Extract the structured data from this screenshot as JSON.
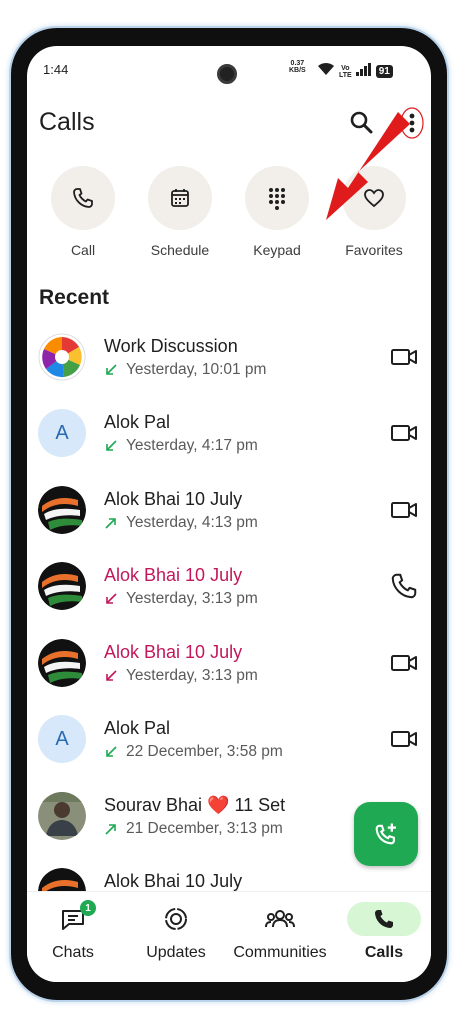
{
  "status_bar": {
    "time": "1:44",
    "net_speed": "0.37",
    "net_unit": "KB/S",
    "lte_top": "Vo",
    "lte_bottom": "LTE",
    "battery": "91"
  },
  "header": {
    "title": "Calls",
    "search_icon": "search-icon",
    "more_icon": "more-vert-icon"
  },
  "quick_actions": [
    {
      "label": "Call",
      "icon": "phone-icon"
    },
    {
      "label": "Schedule",
      "icon": "calendar-icon"
    },
    {
      "label": "Keypad",
      "icon": "dialpad-icon"
    },
    {
      "label": "Favorites",
      "icon": "heart-icon"
    }
  ],
  "recent": {
    "title": "Recent",
    "items": [
      {
        "name": "Work Discussion",
        "detail": "Yesterday, 10:01 pm",
        "direction": "incoming",
        "missed": false,
        "type": "video",
        "avatar": "group-logo"
      },
      {
        "name": "Alok Pal",
        "detail": "Yesterday, 4:17 pm",
        "direction": "incoming",
        "missed": false,
        "type": "video",
        "avatar": "A"
      },
      {
        "name": "Alok Bhai 10 July",
        "detail": "Yesterday, 4:13 pm",
        "direction": "outgoing",
        "missed": false,
        "type": "video",
        "avatar": "flag-photo"
      },
      {
        "name": "Alok Bhai 10 July",
        "detail": "Yesterday, 3:13 pm",
        "direction": "missed",
        "missed": true,
        "type": "voice",
        "avatar": "flag-photo"
      },
      {
        "name": "Alok Bhai 10 July",
        "detail": "Yesterday, 3:13 pm",
        "direction": "missed",
        "missed": true,
        "type": "video",
        "avatar": "flag-photo"
      },
      {
        "name": "Alok Pal",
        "detail": "22 December, 3:58 pm",
        "direction": "incoming",
        "missed": false,
        "type": "video",
        "avatar": "A"
      },
      {
        "name": "Sourav Bhai ❤️ 11 Set",
        "detail": "21 December, 3:13 pm",
        "direction": "outgoing",
        "missed": false,
        "type": "video",
        "avatar": "person-photo"
      },
      {
        "name": "Alok Bhai 10 July",
        "detail": "",
        "direction": "",
        "missed": false,
        "type": "video",
        "avatar": "flag-photo"
      }
    ]
  },
  "fab": {
    "icon": "add-call-icon"
  },
  "bottom_nav": [
    {
      "label": "Chats",
      "icon": "chat-icon",
      "badge": "1",
      "active": false
    },
    {
      "label": "Updates",
      "icon": "status-icon",
      "active": false
    },
    {
      "label": "Communities",
      "icon": "communities-icon",
      "active": false
    },
    {
      "label": "Calls",
      "icon": "phone-icon",
      "active": true
    }
  ],
  "colors": {
    "accent": "#1ea952",
    "missed": "#c2185b",
    "incoming_arrow": "#1ea952",
    "annotation_arrow": "#e01b1b"
  }
}
